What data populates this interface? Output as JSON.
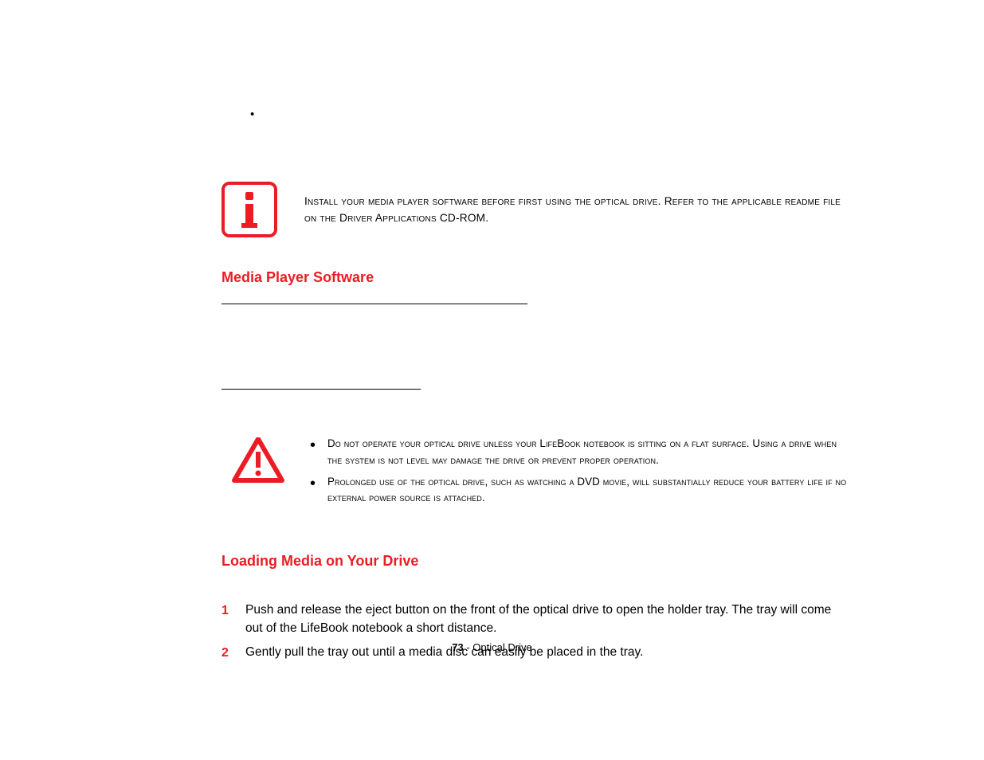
{
  "top_bullet": "•",
  "info_callout": "Install your media player software before first using the optical drive. Refer to the applicable readme file on the Driver Applications CD-ROM.",
  "heading_media": "Media Player Software",
  "warnings": [
    "Do not operate your optical drive unless your LifeBook notebook is sitting on a flat surface. Using a drive when the system is not level may damage the drive or prevent proper operation.",
    "Prolonged use of the optical drive, such as watching a DVD movie, will substantially reduce your battery life if no external power source is attached."
  ],
  "heading_loading": "Loading Media on Your Drive",
  "steps": [
    "Push and release the eject button on the front of the optical drive to open the holder tray. The tray will come out of the LifeBook notebook a short distance.",
    "Gently pull the tray out until a media disc can easily be placed in the tray."
  ],
  "footer_page": "73",
  "footer_sep": " - ",
  "footer_section": "Optical Drive"
}
